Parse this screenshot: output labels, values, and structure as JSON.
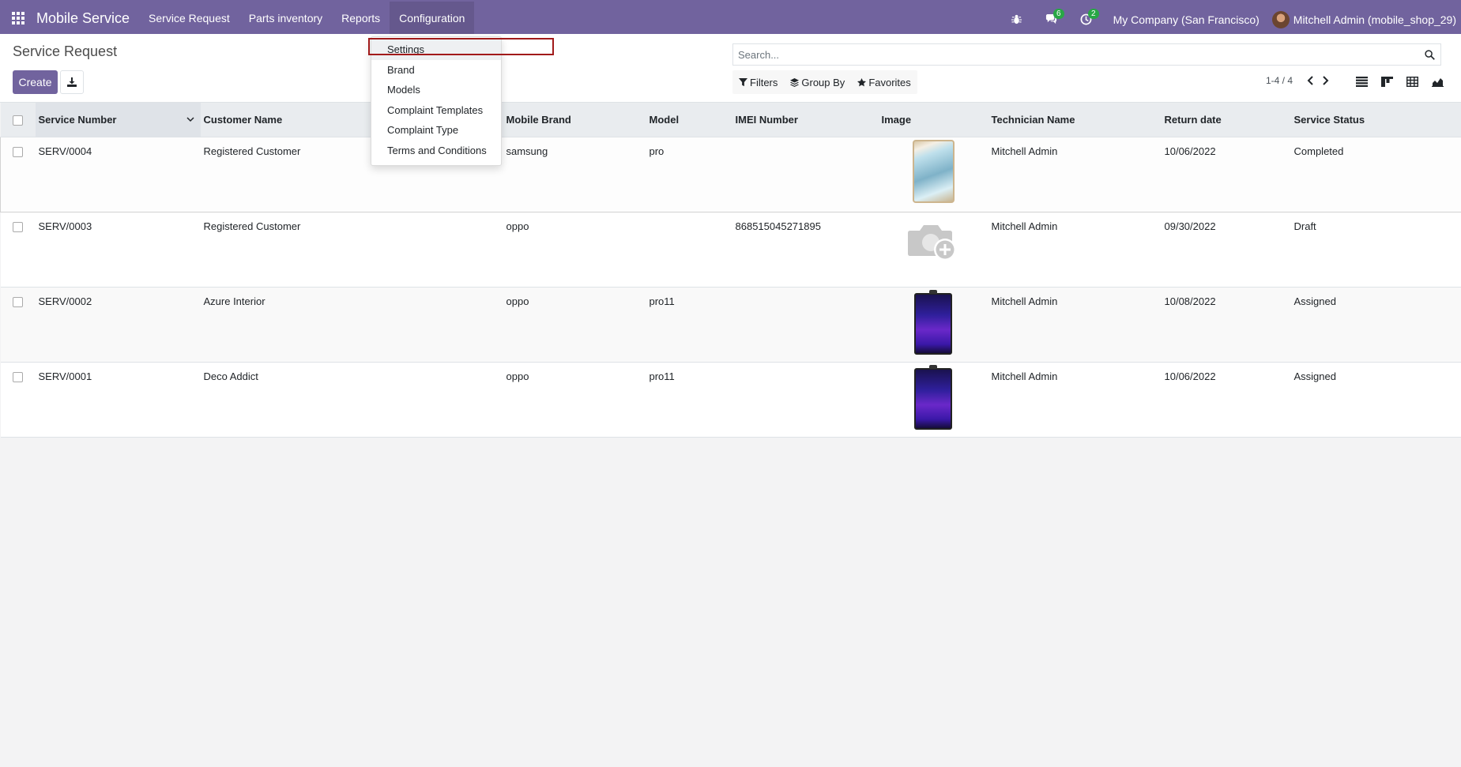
{
  "app": {
    "name": "Mobile Service"
  },
  "menu": [
    {
      "label": "Service Request"
    },
    {
      "label": "Parts inventory"
    },
    {
      "label": "Reports"
    },
    {
      "label": "Configuration"
    }
  ],
  "systray": {
    "messages_count": "6",
    "activities_count": "2",
    "company": "My Company (San Francisco)",
    "user": "Mitchell Admin (mobile_shop_29)"
  },
  "page": {
    "title": "Service Request"
  },
  "buttons": {
    "create": "Create"
  },
  "search": {
    "placeholder": "Search..."
  },
  "filters": {
    "filters": "Filters",
    "group_by": "Group By",
    "favorites": "Favorites"
  },
  "pager": {
    "text": "1-4 / 4"
  },
  "colors": {
    "brand": "#71639e",
    "badge": "#28a745",
    "highlight": "#a11a1a"
  },
  "table": {
    "columns": [
      "Service Number",
      "Customer Name",
      "Mobile Brand",
      "Model",
      "IMEI Number",
      "Image",
      "Technician Name",
      "Return date",
      "Service Status"
    ],
    "rows": [
      {
        "number": "SERV/0004",
        "customer": "Registered Customer",
        "brand": "samsung",
        "model": "pro",
        "imei": "",
        "image": "samsung-phone",
        "technician": "Mitchell Admin",
        "return_date": "10/06/2022",
        "status": "Completed"
      },
      {
        "number": "SERV/0003",
        "customer": "Registered Customer",
        "brand": "oppo",
        "model": "",
        "imei": "868515045271895",
        "image": "camera-placeholder",
        "technician": "Mitchell Admin",
        "return_date": "09/30/2022",
        "status": "Draft"
      },
      {
        "number": "SERV/0002",
        "customer": "Azure Interior",
        "brand": "oppo",
        "model": "pro11",
        "imei": "",
        "image": "oppo-phone",
        "technician": "Mitchell Admin",
        "return_date": "10/08/2022",
        "status": "Assigned"
      },
      {
        "number": "SERV/0001",
        "customer": "Deco Addict",
        "brand": "oppo",
        "model": "pro11",
        "imei": "",
        "image": "oppo-phone",
        "technician": "Mitchell Admin",
        "return_date": "10/06/2022",
        "status": "Assigned"
      }
    ]
  },
  "dropdown": {
    "items": [
      {
        "label": "Settings"
      },
      {
        "label": "Brand"
      },
      {
        "label": "Models"
      },
      {
        "label": "Complaint Templates"
      },
      {
        "label": "Complaint Type"
      },
      {
        "label": "Terms and Conditions"
      }
    ]
  }
}
